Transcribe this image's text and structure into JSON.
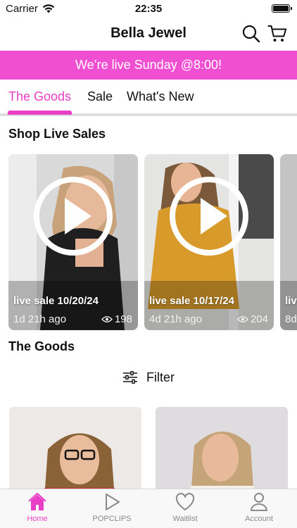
{
  "status_bar": {
    "carrier": "Carrier",
    "time": "22:35"
  },
  "header": {
    "title": "Bella Jewel",
    "search_icon": "search-icon",
    "cart_icon": "cart-icon"
  },
  "banner": {
    "text": "We’re live Sunday @8:00!",
    "color": "#f14fd1"
  },
  "tabs": [
    {
      "label": "The Goods",
      "active": true
    },
    {
      "label": "Sale",
      "active": false
    },
    {
      "label": "What's New",
      "active": false
    }
  ],
  "accent": "#e83fc6",
  "live_section": {
    "title": "Shop Live Sales",
    "cards": [
      {
        "title": "live sale 10/20/24",
        "ago": "1d 21h ago",
        "views": "198"
      },
      {
        "title": "live sale 10/17/24",
        "ago": "4d 21h ago",
        "views": "204"
      },
      {
        "title": "live",
        "ago": "8d"
      }
    ]
  },
  "goods_section": {
    "title": "The Goods",
    "filter_label": "Filter"
  },
  "tabbar": [
    {
      "label": "Home",
      "icon": "home-icon",
      "active": true
    },
    {
      "label": "POPCLIPS",
      "icon": "play-icon",
      "active": false
    },
    {
      "label": "Waitlist",
      "icon": "heart-icon",
      "active": false
    },
    {
      "label": "Account",
      "icon": "person-icon",
      "active": false
    }
  ]
}
